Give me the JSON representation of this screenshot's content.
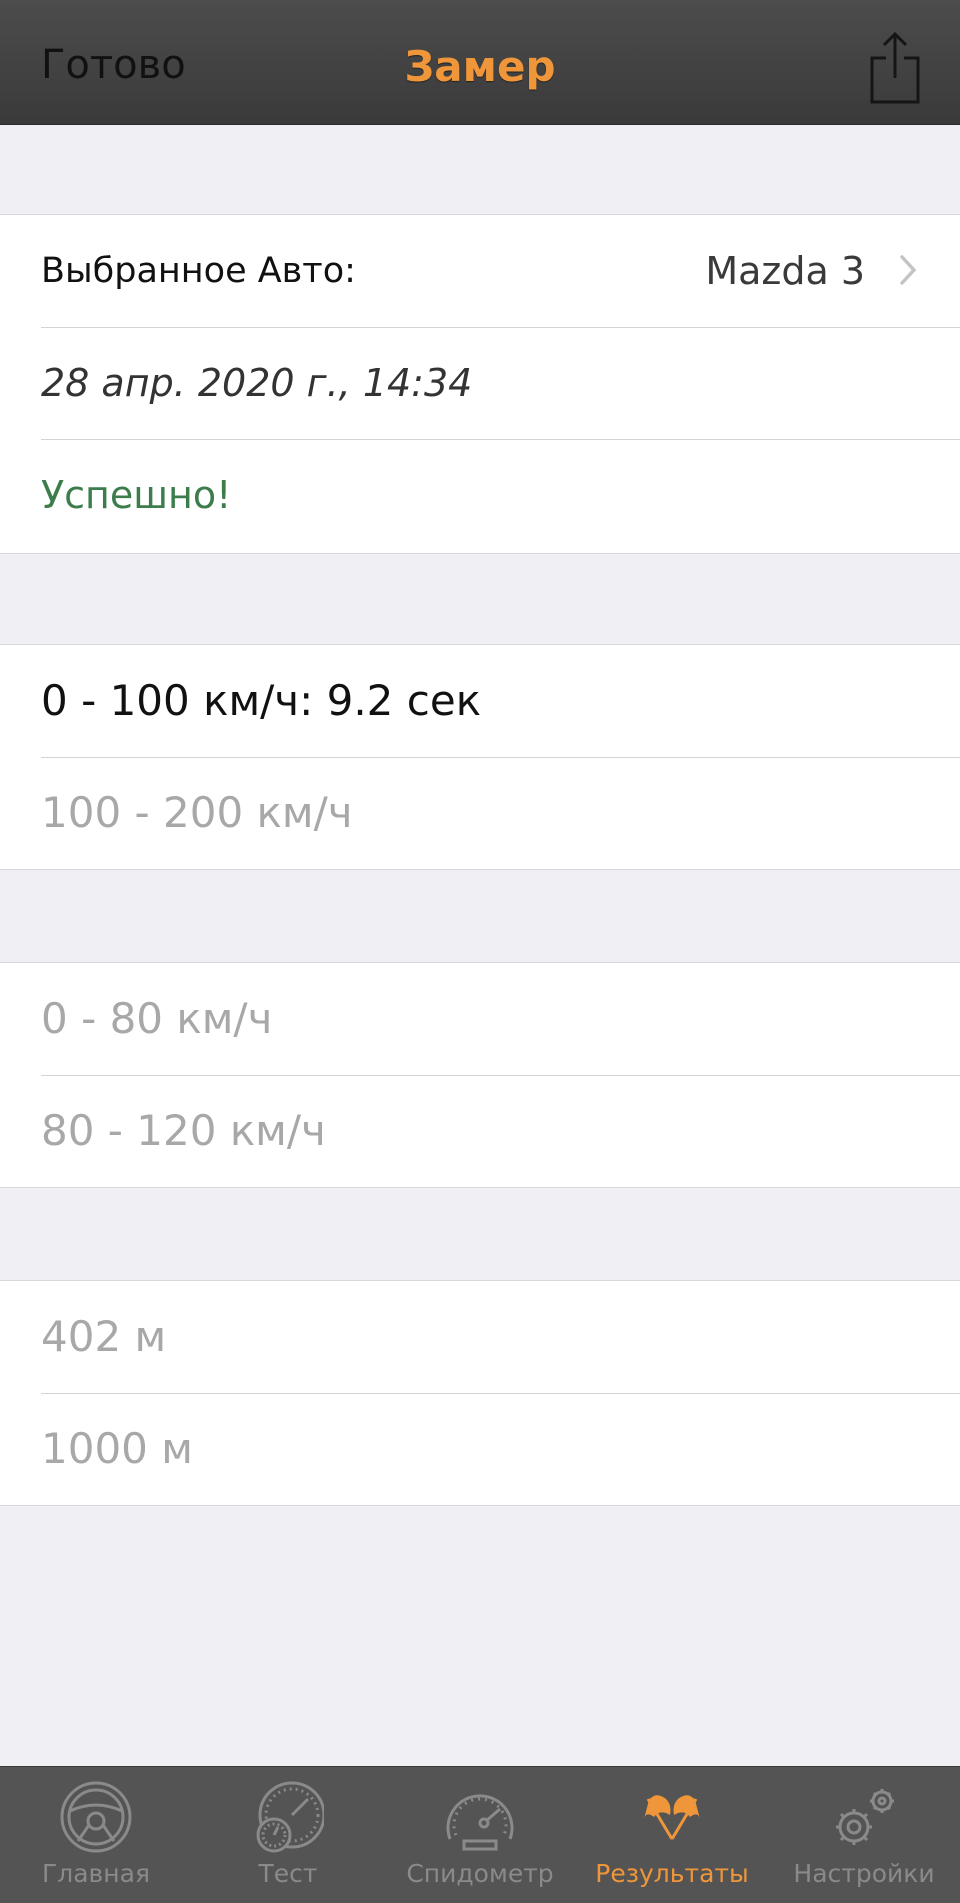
{
  "navbar": {
    "done_label": "Готово",
    "title": "Замер",
    "share_icon": "share-icon"
  },
  "info_section": {
    "car_label": "Выбранное Авто:",
    "car_value": "Mazda 3",
    "date": "28 апр. 2020 г., 14:34",
    "status": "Успешно!"
  },
  "results": {
    "group1": [
      "0 - 100 км/ч: 9.2 сек",
      "100 - 200 км/ч"
    ],
    "group2": [
      "0 - 80 км/ч",
      "80 - 120 км/ч"
    ],
    "group3": [
      "402 м",
      "1000 м"
    ]
  },
  "tabbar": {
    "tabs": [
      {
        "label": "Главная",
        "icon": "steering-wheel-icon"
      },
      {
        "label": "Тест",
        "icon": "stopwatch-gauge-icon"
      },
      {
        "label": "Спидометр",
        "icon": "speedometer-icon"
      },
      {
        "label": "Результаты",
        "icon": "checkered-flags-icon"
      },
      {
        "label": "Настройки",
        "icon": "gears-icon"
      }
    ],
    "active_index": 3
  },
  "colors": {
    "accent": "#f0963a",
    "success": "#3d7d4c",
    "inactive_text": "#a8a8a8",
    "bar": "#545454"
  }
}
